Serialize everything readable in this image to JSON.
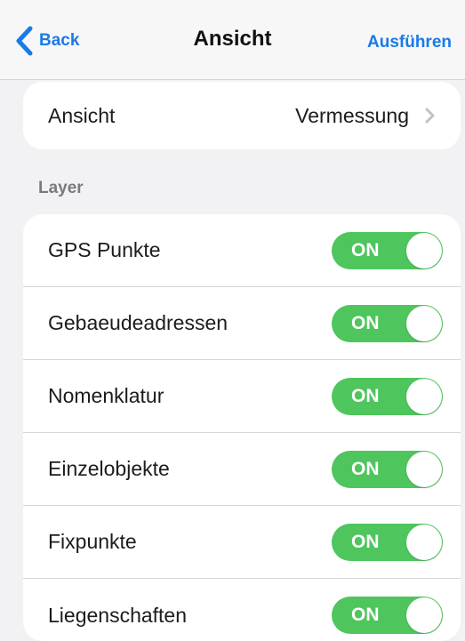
{
  "navbar": {
    "back_label": "Back",
    "back_icon": "chevron-left-icon",
    "title": "Ansicht",
    "action_label": "Ausführen"
  },
  "ansicht": {
    "label": "Ansicht",
    "value": "Vermessung",
    "icon": "chevron-right-icon"
  },
  "layers": {
    "header": "Layer",
    "items": [
      {
        "label": "GPS Punkte",
        "toggle": "ON"
      },
      {
        "label": "Gebaeudeadressen",
        "toggle": "ON"
      },
      {
        "label": "Nomenklatur",
        "toggle": "ON"
      },
      {
        "label": "Einzelobjekte",
        "toggle": "ON"
      },
      {
        "label": "Fixpunkte",
        "toggle": "ON"
      },
      {
        "label": "Liegenschaften",
        "toggle": "ON"
      }
    ]
  },
  "colors": {
    "accent": "#1a7ae8",
    "toggle_on": "#4fc55d",
    "background": "#f2f2f4",
    "card": "#ffffff"
  }
}
